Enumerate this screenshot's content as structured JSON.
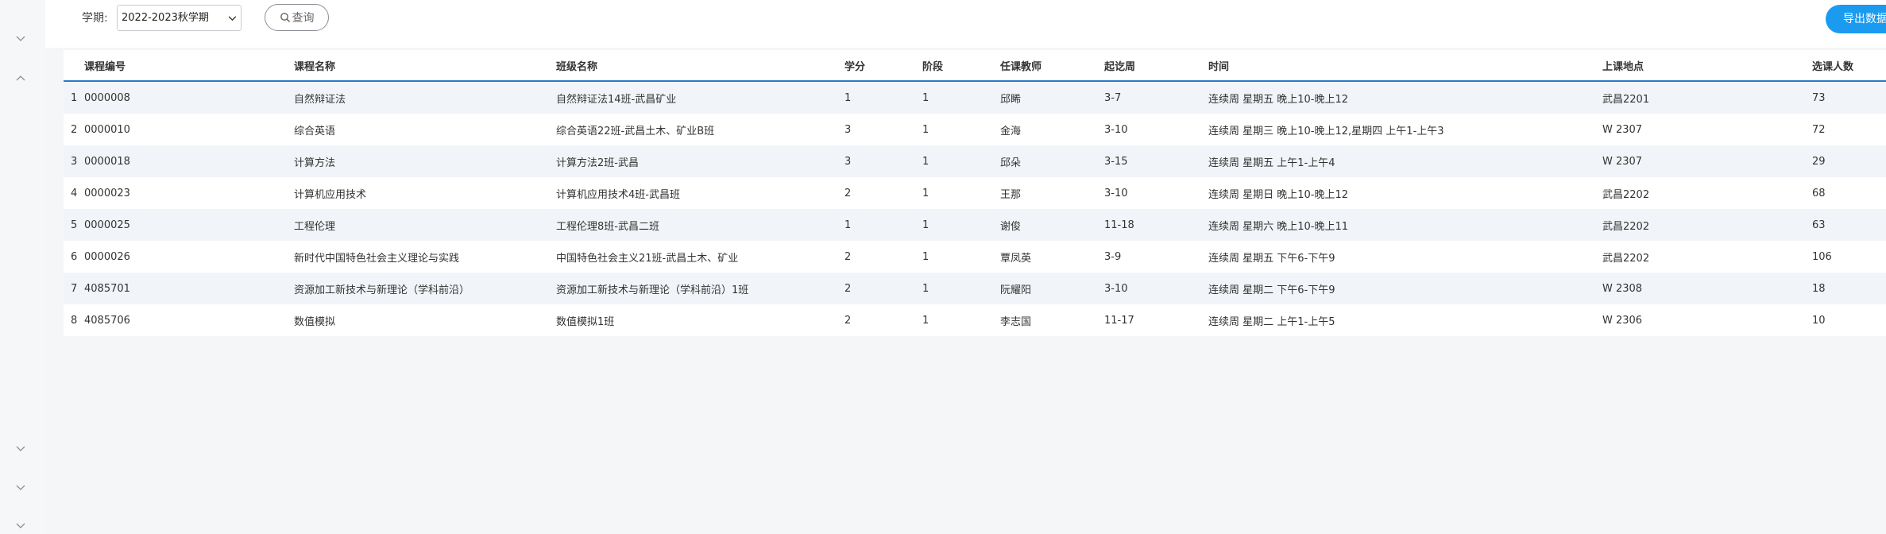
{
  "toolbar": {
    "term_label": "学期:",
    "term_value": "2022-2023秋学期",
    "query_label": "查询",
    "export_label": "导出数据"
  },
  "sidebar": {
    "icons": [
      "chevron-down-icon",
      "chevron-up-icon",
      "chevron-down-icon",
      "chevron-down-icon",
      "chevron-down-icon"
    ]
  },
  "table": {
    "columns": [
      "",
      "课程编号",
      "课程名称",
      "班级名称",
      "学分",
      "阶段",
      "任课教师",
      "起讫周",
      "时间",
      "上课地点",
      "选课人数"
    ],
    "rows": [
      [
        "1",
        "0000008",
        "自然辩证法",
        "自然辩证法14班-武昌矿业",
        "1",
        "1",
        "邱睎",
        "3-7",
        "连续周 星期五 晚上10-晚上12",
        "武昌2201",
        "73"
      ],
      [
        "2",
        "0000010",
        "综合英语",
        "综合英语22班-武昌土木、矿业B班",
        "3",
        "1",
        "金海",
        "3-10",
        "连续周 星期三 晚上10-晚上12,星期四 上午1-上午3",
        "W 2307",
        "72"
      ],
      [
        "3",
        "0000018",
        "计算方法",
        "计算方法2班-武昌",
        "3",
        "1",
        "邱朵",
        "3-15",
        "连续周 星期五 上午1-上午4",
        "W 2307",
        "29"
      ],
      [
        "4",
        "0000023",
        "计算机应用技术",
        "计算机应用技术4班-武昌班",
        "2",
        "1",
        "王那",
        "3-10",
        "连续周 星期日 晚上10-晚上12",
        "武昌2202",
        "68"
      ],
      [
        "5",
        "0000025",
        "工程伦理",
        "工程伦理8班-武昌二班",
        "1",
        "1",
        "谢俊",
        "11-18",
        "连续周 星期六 晚上10-晚上11",
        "武昌2202",
        "63"
      ],
      [
        "6",
        "0000026",
        "新时代中国特色社会主义理论与实践",
        "中国特色社会主义21班-武昌土木、矿业",
        "2",
        "1",
        "覃凤英",
        "3-9",
        "连续周 星期五 下午6-下午9",
        "武昌2202",
        "106"
      ],
      [
        "7",
        "4085701",
        "资源加工新技术与新理论（学科前沿）",
        "资源加工新技术与新理论（学科前沿）1班",
        "2",
        "1",
        "阮耀阳",
        "3-10",
        "连续周 星期二 下午6-下午9",
        "W 2308",
        "18"
      ],
      [
        "8",
        "4085706",
        "数值模拟",
        "数值模拟1班",
        "2",
        "1",
        "李志国",
        "11-17",
        "连续周 星期二 上午1-上午5",
        "W 2306",
        "10"
      ]
    ]
  },
  "colors": {
    "accent": "#1a9bf0",
    "header_rule": "#2a7ac8",
    "stripe": "#f1f4f8"
  }
}
